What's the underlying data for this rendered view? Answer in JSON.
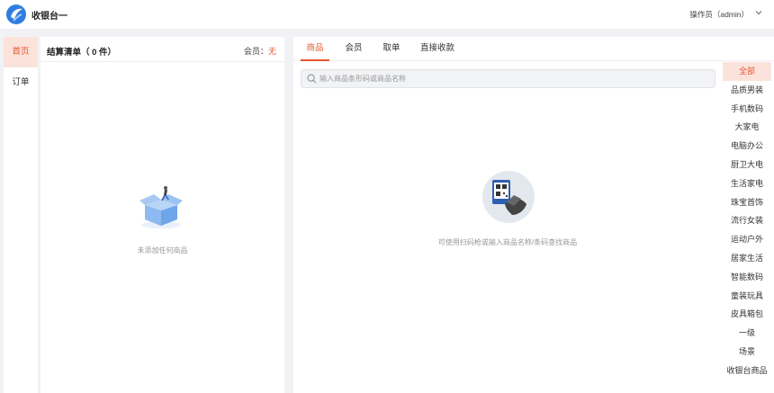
{
  "header": {
    "app_title": "收银台一",
    "operator_label": "操作员（admin）",
    "colors": {
      "accent": "#e4572e",
      "logo_blue": "#2f7de1"
    }
  },
  "leftnav": {
    "items": [
      {
        "label": "首页",
        "active": true
      },
      {
        "label": "订单",
        "active": false
      }
    ]
  },
  "cart": {
    "title": "结算清单（ 0 件）",
    "member_label": "会员：",
    "member_value": "无",
    "empty_text": "未添加任何商品"
  },
  "main": {
    "tabs": [
      {
        "label": "商品",
        "active": true
      },
      {
        "label": "会员",
        "active": false
      },
      {
        "label": "取单",
        "active": false
      },
      {
        "label": "直接收款",
        "active": false
      }
    ],
    "search": {
      "placeholder": "输入商品条形码或商品名称",
      "value": ""
    },
    "empty_hint": "可使用扫码枪或输入商品名称/条码查找商品"
  },
  "categories": [
    "全部",
    "品质男装",
    "手机数码",
    "大家电",
    "电脑办公",
    "厨卫大电",
    "生活家电",
    "珠宝首饰",
    "流行女装",
    "运动户外",
    "居家生活",
    "智能数码",
    "童装玩具",
    "皮具箱包",
    "一级",
    "场景",
    "收银台商品"
  ]
}
